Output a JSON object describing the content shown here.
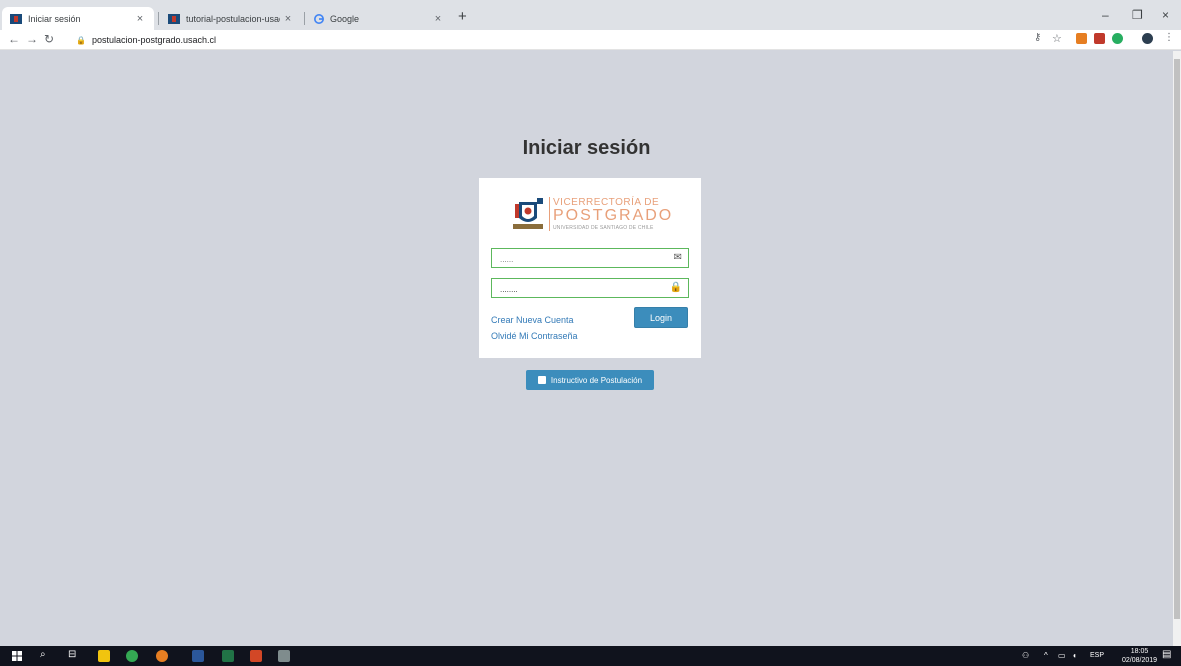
{
  "browser": {
    "tabs": [
      {
        "title": "Iniciar sesión",
        "active": true,
        "close": "×"
      },
      {
        "title": "tutorial-postulacion-usach.pdf",
        "active": false,
        "close": "×"
      },
      {
        "title": "Google",
        "active": false,
        "close": "×"
      }
    ],
    "new_tab": "+",
    "window_controls": {
      "minimize": "–",
      "restore": "❐",
      "close": "×"
    },
    "url": "postulacion-postgrado.usach.cl"
  },
  "page": {
    "title": "Iniciar sesión",
    "logo": {
      "line1": "VICERRECTORÍA DE",
      "line2": "POSTGRADO",
      "line3": "UNIVERSIDAD DE SANTIAGO DE CHILE"
    },
    "email_field": {
      "placeholder": "......",
      "value": ""
    },
    "password_field": {
      "value": "........"
    },
    "links": {
      "create_account": "Crear Nueva Cuenta",
      "forgot_password": "Olvidé Mi Contraseña"
    },
    "login_label": "Login",
    "instructions_label": "Instructivo de Postulación"
  },
  "taskbar": {
    "language": "ESP",
    "time": "18:05",
    "date": "02/08/2019"
  },
  "colors": {
    "page_bg": "#d2d5dd",
    "button": "#3c8dbc",
    "field_border": "#5cb85c",
    "logo_accent": "#e8a07a",
    "link": "#337ab7"
  }
}
